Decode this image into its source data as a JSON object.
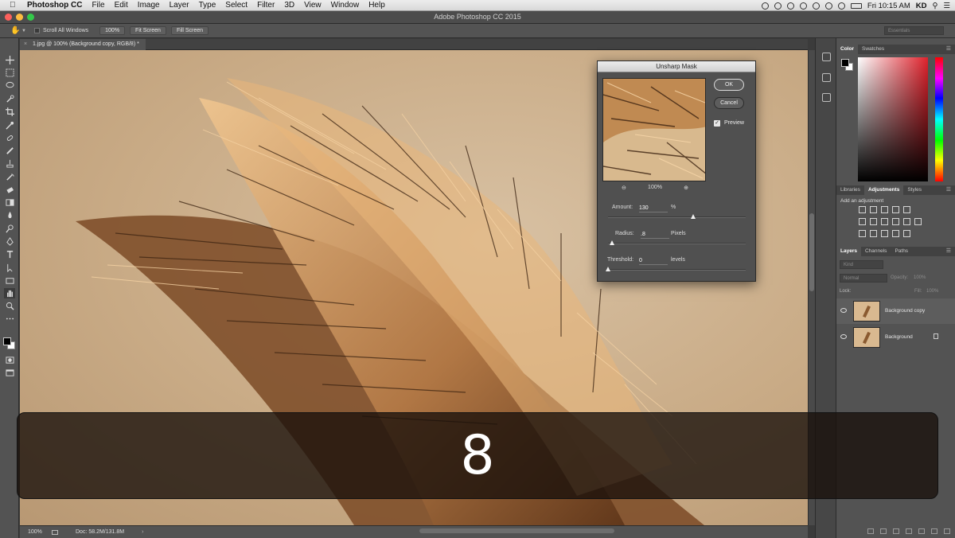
{
  "menubar": {
    "app_name": "Photoshop CC",
    "items": [
      "File",
      "Edit",
      "Image",
      "Layer",
      "Type",
      "Select",
      "Filter",
      "3D",
      "View",
      "Window",
      "Help"
    ],
    "clock": "Fri 10:15 AM",
    "user": "KD"
  },
  "window": {
    "title": "Adobe Photoshop CC 2015"
  },
  "options_bar": {
    "scroll_all_label": "Scroll All Windows",
    "btn_100": "100%",
    "btn_fit": "Fit Screen",
    "btn_fill": "Fill Screen",
    "workspace": "Essentials"
  },
  "document": {
    "tab_label": "1.jpg @ 100% (Background copy, RGB/8) *"
  },
  "status": {
    "zoom": "100%",
    "doc": "Doc: 58.2M/131.8M"
  },
  "dialog": {
    "title": "Unsharp Mask",
    "ok": "OK",
    "cancel": "Cancel",
    "preview_label": "Preview",
    "preview_zoom": "100%",
    "amount_label": "Amount:",
    "amount_value": "130",
    "amount_unit": "%",
    "amount_slider": 0.62,
    "radius_label": "Radius:",
    "radius_value": ".8",
    "radius_unit": "Pixels",
    "radius_slider": 0.03,
    "threshold_label": "Threshold:",
    "threshold_value": "0",
    "threshold_unit": "levels",
    "threshold_slider": 0.0
  },
  "panels": {
    "color_tabs": [
      "Color",
      "Swatches"
    ],
    "adj_tabs": [
      "Libraries",
      "Adjustments",
      "Styles"
    ],
    "add_adjustment": "Add an adjustment",
    "layer_tabs": [
      "Layers",
      "Channels",
      "Paths"
    ],
    "kind_placeholder": "Kind",
    "blend_mode": "Normal",
    "opacity_label": "Opacity:",
    "opacity_value": "100%",
    "lock_label": "Lock:",
    "fill_label": "Fill:",
    "fill_value": "100%",
    "layers": [
      {
        "name": "Background copy",
        "selected": true
      },
      {
        "name": "Background",
        "selected": false
      }
    ]
  },
  "overlay": {
    "number": "8"
  },
  "colors": {
    "accent": "#fc605c",
    "canvas": "#c9ab86"
  }
}
